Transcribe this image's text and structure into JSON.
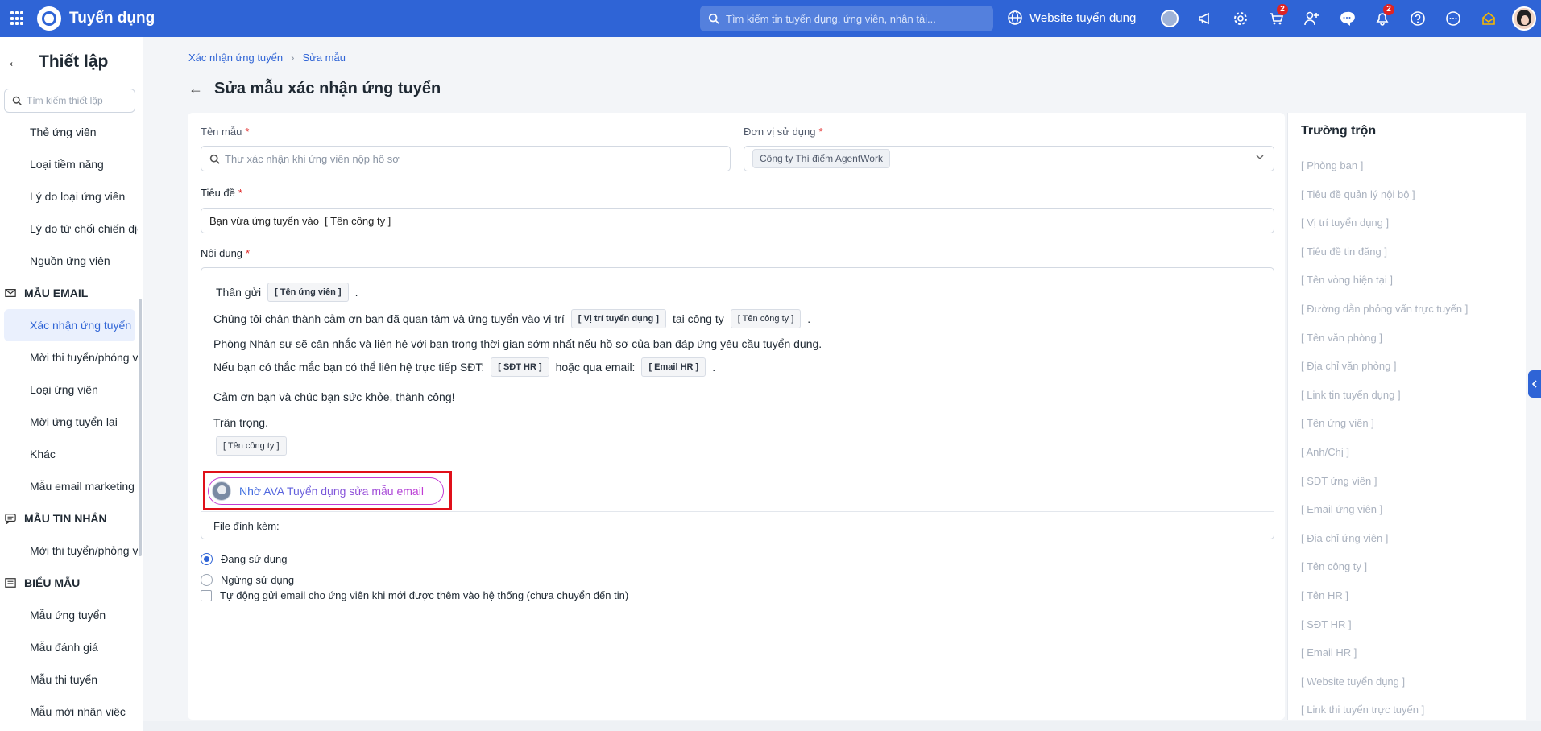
{
  "app": {
    "title": "Tuyển dụng"
  },
  "topbar": {
    "search_placeholder": "Tìm kiếm tin tuyển dụng, ứng viên, nhân tài...",
    "website_label": "Website tuyển dụng",
    "cart_badge": "2",
    "notification_badge": "2"
  },
  "sidebar": {
    "title": "Thiết lập",
    "search_placeholder": "Tìm kiếm thiết lập",
    "items_top": [
      "Thẻ ứng viên",
      "Loại tiềm năng",
      "Lý do loại ứng viên",
      "Lý do từ chối chiến dịch",
      "Nguồn ứng viên"
    ],
    "group_email": "MẪU EMAIL",
    "items_email": [
      "Xác nhận ứng tuyển",
      "Mời thi tuyển/phỏng vấn",
      "Loại ứng viên",
      "Mời ứng tuyển lại",
      "Khác",
      "Mẫu email marketing"
    ],
    "group_sms": "MẪU TIN NHẮN",
    "items_sms": [
      "Mời thi tuyển/phỏng vấn"
    ],
    "group_forms": "BIỂU MẪU",
    "items_forms": [
      "Mẫu ứng tuyển",
      "Mẫu đánh giá",
      "Mẫu thi tuyển",
      "Mẫu mời nhận việc"
    ]
  },
  "breadcrumb": {
    "parent": "Xác nhận ứng tuyển",
    "current": "Sửa mẫu"
  },
  "page": {
    "title": "Sửa mẫu xác nhận ứng tuyển"
  },
  "form": {
    "name_label": "Tên mẫu",
    "name_placeholder": "Thư xác nhận khi ứng viên nộp hồ sơ",
    "unit_label": "Đơn vị sử dụng",
    "unit_value": "Công ty Thí điểm AgentWork",
    "subject_label": "Tiêu đề",
    "subject_value": "Bạn vừa ứng tuyển vào  [ Tên công ty ]",
    "content_label": "Nội dung",
    "required_mark": "*",
    "content": {
      "l1_text": "Thân gửi",
      "l1_tag": "[ Tên ứng viên ]",
      "l1_end": ".",
      "l2_text": "Chúng tôi chân thành cảm ơn bạn đã quan tâm và ứng tuyển vào vị trí",
      "l2_tag1": "[ Vị trí tuyển dụng ]",
      "l2_mid": "tại công ty",
      "l2_tag2": "[ Tên công ty ]",
      "l2_end": ".",
      "l3_text": "Phòng Nhân sự sẽ cân nhắc và liên hệ với bạn trong thời gian sớm nhất nếu hồ sơ của bạn đáp ứng yêu cầu tuyển dụng.",
      "l4_text": "Nếu bạn có thắc mắc bạn có thể liên hệ trực tiếp SĐT:",
      "l4_tag1": "[ SĐT HR ]",
      "l4_mid": "hoặc qua email:",
      "l4_tag2": "[ Email HR ]",
      "l4_end": ".",
      "l5_text": "Cảm ơn bạn và chúc bạn sức khỏe, thành công!",
      "l6_text": "Trân trọng.",
      "l7_tag": "[ Tên công ty ]"
    },
    "ava_button": "Nhờ AVA Tuyển dụng sửa mẫu email",
    "attachment_label": "File đính kèm:",
    "status_active": "Đang sử dụng",
    "status_inactive": "Ngừng sử dụng",
    "auto_send_label": "Tự động gửi email cho ứng viên khi mới được thêm vào hệ thống (chưa chuyển đến tin)"
  },
  "merge_fields": {
    "title": "Trường trộn",
    "items": [
      "[ Phòng ban ]",
      "[ Tiêu đề quản lý nội bộ ]",
      "[ Vị trí tuyển dụng ]",
      "[ Tiêu đề tin đăng ]",
      "[ Tên vòng hiện tại ]",
      "[ Đường dẫn phỏng vấn trực tuyến ]",
      "[ Tên văn phòng ]",
      "[ Địa chỉ văn phòng ]",
      "[ Link tin tuyển dụng ]",
      "[ Tên ứng viên ]",
      "[ Anh/Chị ]",
      "[ SĐT ứng viên ]",
      "[ Email ứng viên ]",
      "[ Địa chỉ ứng viên ]",
      "[ Tên công ty ]",
      "[ Tên HR ]",
      "[ SĐT HR ]",
      "[ Email HR ]",
      "[ Website tuyển dụng ]",
      "[ Link thi tuyển trực tuyến ]"
    ]
  },
  "colors": {
    "brand": "#2f64d6",
    "highlight": "#e0101a",
    "ava_gradient_end": "#c23bd4"
  }
}
